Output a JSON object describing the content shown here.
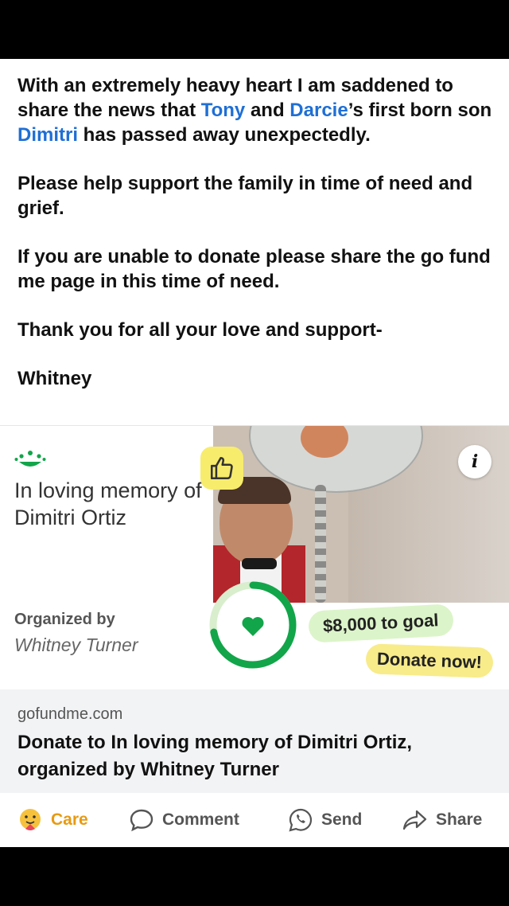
{
  "post": {
    "p1_before_tony": "With an extremely heavy heart I am saddened to share the news that ",
    "mention_tony": "Tony",
    "p1_and": " and ",
    "mention_darcie": "Darcie",
    "p1_first_born": "’s first born son ",
    "mention_dimitri": "Dimitri",
    "p1_after": " has passed away unexpectedly.",
    "p2": "Please help support the family in time of need and grief.",
    "p3": "If you are unable to donate please share the go fund me page in this time of need.",
    "p4": "Thank you for all your love and support-",
    "p5": "Whitney"
  },
  "card": {
    "title": "In loving memory of Dimitri Ortiz",
    "organized_by_label": "Organized by",
    "organizer": "Whitney Turner",
    "goal_text": "$8,000 to goal",
    "donate_label": "Donate now!",
    "ring_progress": 0.72,
    "ring_color": "#12a54a"
  },
  "link": {
    "domain": "gofundme.com",
    "title": "Donate to In loving memory of Dimitri Ortiz, organized by Whitney Turner"
  },
  "actions": {
    "care": "Care",
    "comment": "Comment",
    "send": "Send",
    "share": "Share"
  },
  "colors": {
    "mention": "#1f6fd6",
    "care": "#e89a12",
    "gofundme_green": "#12a54a"
  }
}
